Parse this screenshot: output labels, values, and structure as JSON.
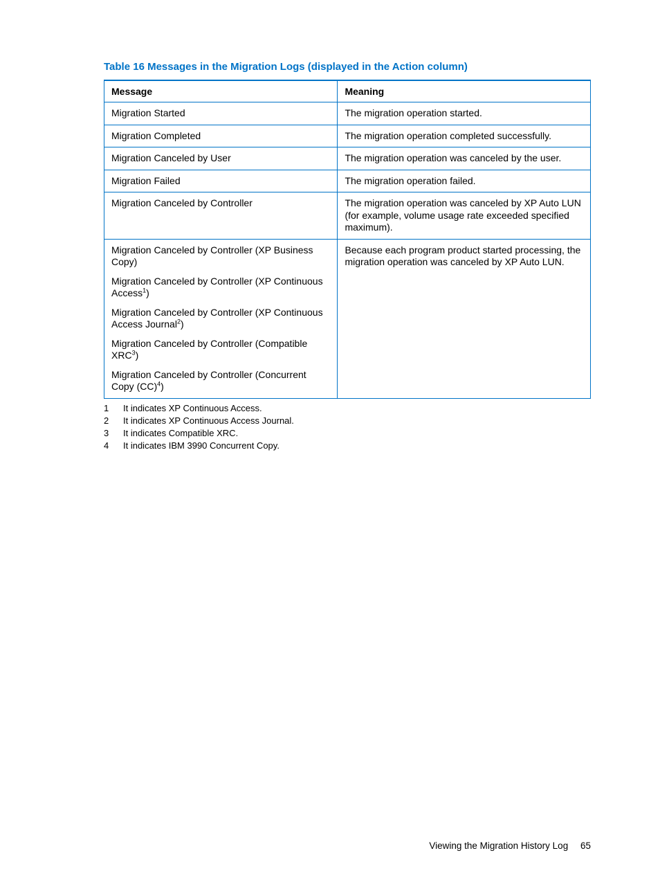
{
  "table": {
    "title": "Table 16 Messages in the Migration Logs (displayed in the Action column)",
    "headers": {
      "message": "Message",
      "meaning": "Meaning"
    },
    "rows": [
      {
        "message": "Migration Started",
        "meaning": "The migration operation started."
      },
      {
        "message": "Migration Completed",
        "meaning": "The migration operation completed successfully."
      },
      {
        "message": "Migration Canceled by User",
        "meaning": "The migration operation was canceled by the user."
      },
      {
        "message": "Migration Failed",
        "meaning": "The migration operation failed."
      },
      {
        "message": "Migration Canceled by Controller",
        "meaning": "The migration operation was canceled by XP Auto LUN (for example, volume usage rate exceeded specified maximum)."
      }
    ],
    "grouped_row": {
      "messages": {
        "m1": "Migration Canceled by Controller (XP Business Copy)",
        "m2a": "Migration Canceled by Controller (XP Continuous Access",
        "m2b": ")",
        "m3a": "Migration Canceled by Controller (XP Continuous Access Journal",
        "m3b": ")",
        "m4a": "Migration Canceled by Controller (Compatible XRC",
        "m4b": ")",
        "m5a": "Migration Canceled by Controller (Concurrent Copy (CC)",
        "m5b": ")"
      },
      "sups": {
        "s1": "1",
        "s2": "2",
        "s3": "3",
        "s4": "4"
      },
      "meaning": "Because each program product started processing, the migration operation was canceled by XP Auto LUN."
    }
  },
  "footnotes": [
    {
      "num": "1",
      "text": "It indicates XP Continuous Access."
    },
    {
      "num": "2",
      "text": "It indicates XP Continuous Access Journal."
    },
    {
      "num": "3",
      "text": "It indicates Compatible XRC."
    },
    {
      "num": "4",
      "text": "It indicates IBM 3990 Concurrent Copy."
    }
  ],
  "footer": {
    "section": "Viewing the Migration History Log",
    "page": "65"
  }
}
